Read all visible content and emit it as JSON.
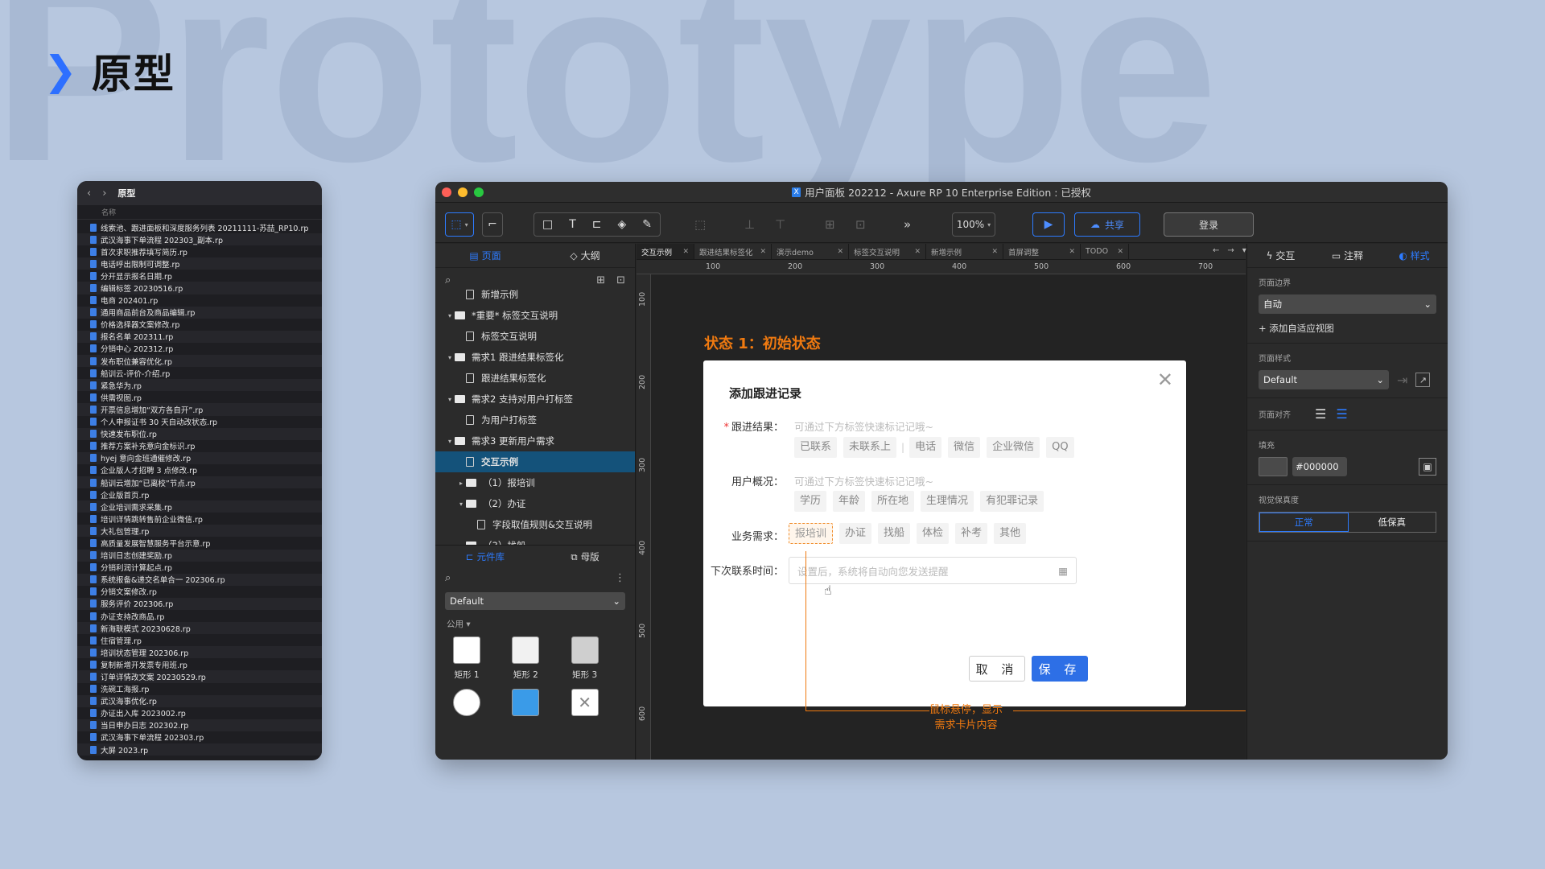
{
  "slide": {
    "bg_word": "Prototype",
    "title": "原型"
  },
  "finder": {
    "title": "原型",
    "col_header": "名称",
    "files": [
      "线索池、跟进面板和深度服务列表 20211111-苏喆_RP10.rp",
      "武汉海事下单流程 202303_副本.rp",
      "首次求职推荐填写简历.rp",
      "电话呼出限制可调整.rp",
      "分开显示报名日期.rp",
      "编辑标签 20230516.rp",
      "电商 202401.rp",
      "通用商品前台及商品编辑.rp",
      "价格选择器文案修改.rp",
      "报名名单 202311.rp",
      "分销中心 202312.rp",
      "发布职位兼容优化.rp",
      "船训云-评价-介绍.rp",
      "紧急华为.rp",
      "供需视图.rp",
      "开票信息增加“双方各自开”.rp",
      "个人申报证书 30 天自动改状态.rp",
      "快速发布职位.rp",
      "推荐方案补充意向金标识.rp",
      "hyej 意向金班通催修改.rp",
      "企业版人才招聘 3 点修改.rp",
      "船训云增加“已离校”节点.rp",
      "企业版首页.rp",
      "企业培训需求采集.rp",
      "培训详情跳转售前企业微信.rp",
      "大礼包管理.rp",
      "高质量发展智慧服务平台示意.rp",
      "培训日志创建奖励.rp",
      "分销利润计算起点.rp",
      "系统报备&递交名单合一 202306.rp",
      "分销文案修改.rp",
      "服务评价 202306.rp",
      "办证支持改商品.rp",
      "新海联模式 20230628.rp",
      "住宿管理.rp",
      "培训状态管理 202306.rp",
      "复制新增开发票专用班.rp",
      "订单详情改文案 20230529.rp",
      "洗碗工海报.rp",
      "武汉海事优化.rp",
      "办证出入库 2023002.rp",
      "当日申办日志 202302.rp",
      "武汉海事下单流程 202303.rp",
      "大屏 2023.rp"
    ]
  },
  "window": {
    "title": "用户面板 202212 - Axure RP 10 Enterprise Edition : 已授权",
    "logo": "X",
    "zoom": "100%",
    "share_label": "共享",
    "login_label": "登录",
    "more": "»"
  },
  "left_panel": {
    "tab_pages": "页面",
    "tab_outline": "大纲",
    "tree": [
      {
        "label": "新增示例",
        "type": "page",
        "indent": 1,
        "caret": ""
      },
      {
        "label": "*重要* 标签交互说明",
        "type": "folder",
        "indent": 0,
        "caret": "▾"
      },
      {
        "label": "标签交互说明",
        "type": "page",
        "indent": 1,
        "caret": ""
      },
      {
        "label": "需求1 跟进结果标签化",
        "type": "folder",
        "indent": 0,
        "caret": "▾"
      },
      {
        "label": "跟进结果标签化",
        "type": "page",
        "indent": 1,
        "caret": ""
      },
      {
        "label": "需求2 支持对用户打标签",
        "type": "folder",
        "indent": 0,
        "caret": "▾"
      },
      {
        "label": "为用户打标签",
        "type": "page",
        "indent": 1,
        "caret": ""
      },
      {
        "label": "需求3 更新用户需求",
        "type": "folder",
        "indent": 0,
        "caret": "▾"
      },
      {
        "label": "交互示例",
        "type": "page",
        "indent": 1,
        "caret": "",
        "selected": true
      },
      {
        "label": "（1）报培训",
        "type": "folder",
        "indent": 1,
        "caret": "▸"
      },
      {
        "label": "（2）办证",
        "type": "folder",
        "indent": 1,
        "caret": "▾"
      },
      {
        "label": "字段取值规则&交互说明",
        "type": "page",
        "indent": 2,
        "caret": ""
      },
      {
        "label": "（3）找船",
        "type": "folder",
        "indent": 1,
        "caret": "▸"
      }
    ],
    "lib_tab": "元件库",
    "master_tab": "母版",
    "lib_select": "Default",
    "lib_group": "公用 ▾",
    "widgets": [
      "矩形 1",
      "矩形 2",
      "矩形 3"
    ]
  },
  "doc_tabs": [
    "交互示例",
    "跟进结果标签化",
    "演示demo",
    "标签交互说明",
    "新增示例",
    "首屏调整",
    "TODO"
  ],
  "ruler_h": [
    "100",
    "200",
    "300",
    "400",
    "500",
    "600",
    "700"
  ],
  "ruler_v": [
    "100",
    "200",
    "300",
    "400",
    "500",
    "600"
  ],
  "canvas": {
    "state_label": "状态 1：初始状态",
    "dialog_title": "添加跟进记录",
    "result_label": "跟进结果：",
    "result_hint": "可通过下方标签快速标记记哦~",
    "result_tags": [
      "已联系",
      "未联系上",
      "电话",
      "微信",
      "企业微信",
      "QQ"
    ],
    "profile_label": "用户概况：",
    "profile_hint": "可通过下方标签快速标记记哦~",
    "profile_tags": [
      "学历",
      "年龄",
      "所在地",
      "生理情况",
      "有犯罪记录"
    ],
    "demand_label": "业务需求：",
    "demand_tags": [
      "报培训",
      "办证",
      "找船",
      "体检",
      "补考",
      "其他"
    ],
    "next_label": "下次联系时间：",
    "next_placeholder": "设置后，系统将自动向您发送提醒",
    "cancel": "取 消",
    "save": "保 存",
    "annotation_1": "鼠标悬停，显示",
    "annotation_2": "需求卡片内容"
  },
  "right_panel": {
    "tab_interact": "交互",
    "tab_notes": "注释",
    "tab_style": "样式",
    "page_border": "页面边界",
    "border_value": "自动",
    "add_view": "+ 添加自适应视图",
    "page_style": "页面样式",
    "style_value": "Default",
    "align": "页面对齐",
    "fill": "填充",
    "fill_hex": "#000000",
    "fidelity": "视觉保真度",
    "fid_normal": "正常",
    "fid_low": "低保真"
  },
  "colors": {
    "accent": "#2d7bff",
    "annotation": "#f07a10"
  }
}
